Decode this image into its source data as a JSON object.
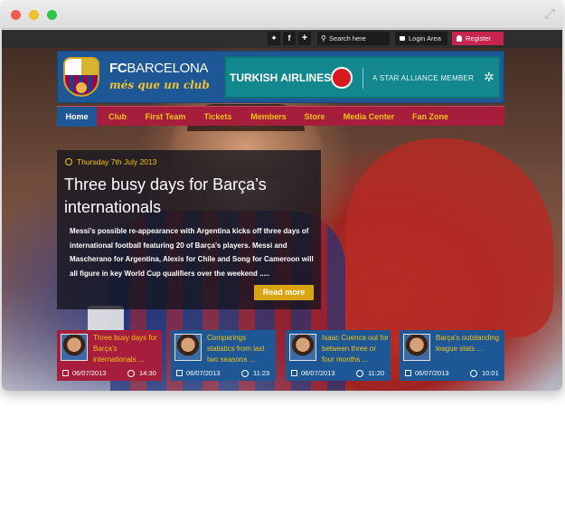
{
  "utility_bar": {
    "social": [
      {
        "name": "twitter-icon",
        "glyph": "✦"
      },
      {
        "name": "facebook-icon",
        "glyph": "f"
      },
      {
        "name": "plus-icon",
        "glyph": "+"
      }
    ],
    "search_placeholder": "Search here",
    "login_label": "Login Area",
    "register_label": "Register"
  },
  "header": {
    "brand_bold": "FC",
    "brand_rest": "BARCELONA",
    "motto": "més que un club",
    "sponsor": {
      "name": "TURKISH AIRLINES",
      "tagline": "A STAR ALLIANCE MEMBER"
    }
  },
  "nav": {
    "items": [
      {
        "label": "Home",
        "active": true
      },
      {
        "label": "Club"
      },
      {
        "label": "First Team"
      },
      {
        "label": "Tickets"
      },
      {
        "label": "Members"
      },
      {
        "label": "Store"
      },
      {
        "label": "Media Center"
      },
      {
        "label": "Fan Zone"
      }
    ]
  },
  "feature": {
    "date": "Thursday 7th July 2013",
    "title": "Three busy days for Barça’s internationals",
    "body": "Messi’s possible re-appearance with Argentina kicks off three days of international football featuring 20 of Barça’s players. Messi and Mascherano for Argentina, Alexis for Chile and Song for Cameroon will all figure in key World Cup qualifiers over the weekend .....",
    "read_more": "Read more"
  },
  "cards": [
    {
      "title": "Three busy days for Barça’s internationals ...",
      "date": "06/07/2013",
      "time": "14:30",
      "active": true
    },
    {
      "title": "Comparings statistics from last two seasons ...",
      "date": "06/07/2013",
      "time": "11:23"
    },
    {
      "title": "Isaac Cuenca out for between three or four months ...",
      "date": "06/07/2013",
      "time": "11:20"
    },
    {
      "title": "Barça’s outstanding league stats ...",
      "date": "06/07/2013",
      "time": "10:01"
    }
  ],
  "colors": {
    "blaugrana_blue": "#1d5796",
    "blaugrana_red": "#a71e3c",
    "gold": "#f2c316",
    "register_pink": "#c6234e"
  }
}
